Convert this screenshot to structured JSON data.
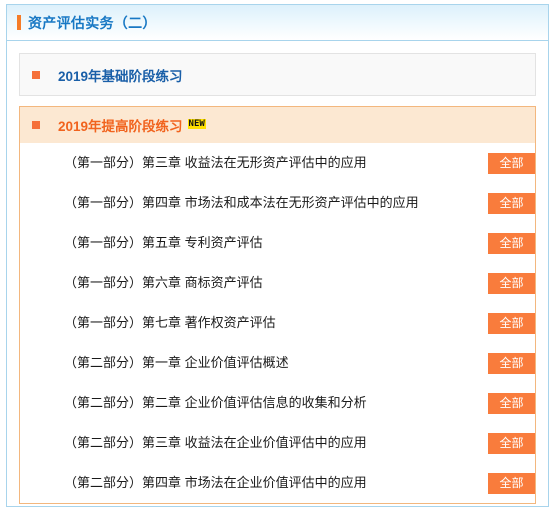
{
  "header": {
    "title": "资产评估实务（二）",
    "accent_bar_color": "#f57c28",
    "title_color": "#1878c4"
  },
  "sections": [
    {
      "id": "basic-stage-2019",
      "label": "2019年基础阶段练习",
      "state": "collapsed",
      "bullet_color": "#f5703a",
      "label_color": "#1a5fa8",
      "badge": null,
      "items": []
    },
    {
      "id": "advanced-stage-2019",
      "label": "2019年提高阶段练习",
      "state": "expanded",
      "bullet_color": "#f5703a",
      "label_color": "#f1631e",
      "badge": "NEW",
      "badge_bg": "#ffe000",
      "items": [
        {
          "text": "（第一部分）第三章  收益法在无形资产评估中的应用",
          "action": "全部"
        },
        {
          "text": "（第一部分）第四章   市场法和成本法在无形资产评估中的应用",
          "action": "全部"
        },
        {
          "text": "（第一部分）第五章   专利资产评估",
          "action": "全部"
        },
        {
          "text": "（第一部分）第六章   商标资产评估",
          "action": "全部"
        },
        {
          "text": "（第一部分）第七章   著作权资产评估",
          "action": "全部"
        },
        {
          "text": "（第二部分）第一章  企业价值评估概述",
          "action": "全部"
        },
        {
          "text": "（第二部分）第二章  企业价值评估信息的收集和分析",
          "action": "全部"
        },
        {
          "text": "（第二部分）第三章  收益法在企业价值评估中的应用",
          "action": "全部"
        },
        {
          "text": "（第二部分）第四章  市场法在企业价值评估中的应用",
          "action": "全部"
        }
      ]
    }
  ],
  "colors": {
    "card_border": "#a8d4ec",
    "button_orange": "#f97c3c",
    "section_expanded_bg": "#fce8d2",
    "section_collapsed_bg": "#f9f9f9"
  }
}
